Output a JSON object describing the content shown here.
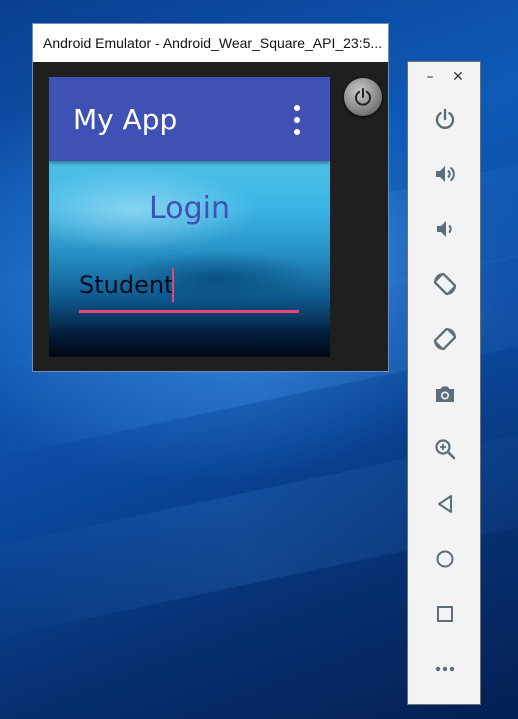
{
  "emulator": {
    "window_title": "Android Emulator - Android_Wear_Square_API_23:5..."
  },
  "app": {
    "title": "My App",
    "login_label": "Login",
    "student_input_value": "Student",
    "colors": {
      "app_bar": "#3f51b5",
      "accent": "#e6457a",
      "login_text": "#3f51b5"
    }
  },
  "toolbar": {
    "window_controls": [
      {
        "name": "minimize",
        "glyph": "–"
      },
      {
        "name": "close",
        "glyph": "✕"
      }
    ],
    "buttons": [
      {
        "name": "power",
        "icon": "power-icon"
      },
      {
        "name": "volume-up",
        "icon": "volume-up-icon"
      },
      {
        "name": "volume-down",
        "icon": "volume-down-icon"
      },
      {
        "name": "rotate-left",
        "icon": "rotate-left-icon"
      },
      {
        "name": "rotate-right",
        "icon": "rotate-right-icon"
      },
      {
        "name": "screenshot",
        "icon": "camera-icon"
      },
      {
        "name": "zoom",
        "icon": "zoom-icon"
      },
      {
        "name": "back",
        "icon": "back-triangle-icon"
      },
      {
        "name": "home",
        "icon": "home-circle-icon"
      },
      {
        "name": "overview",
        "icon": "overview-square-icon"
      },
      {
        "name": "more",
        "icon": "more-dots-icon"
      }
    ]
  }
}
